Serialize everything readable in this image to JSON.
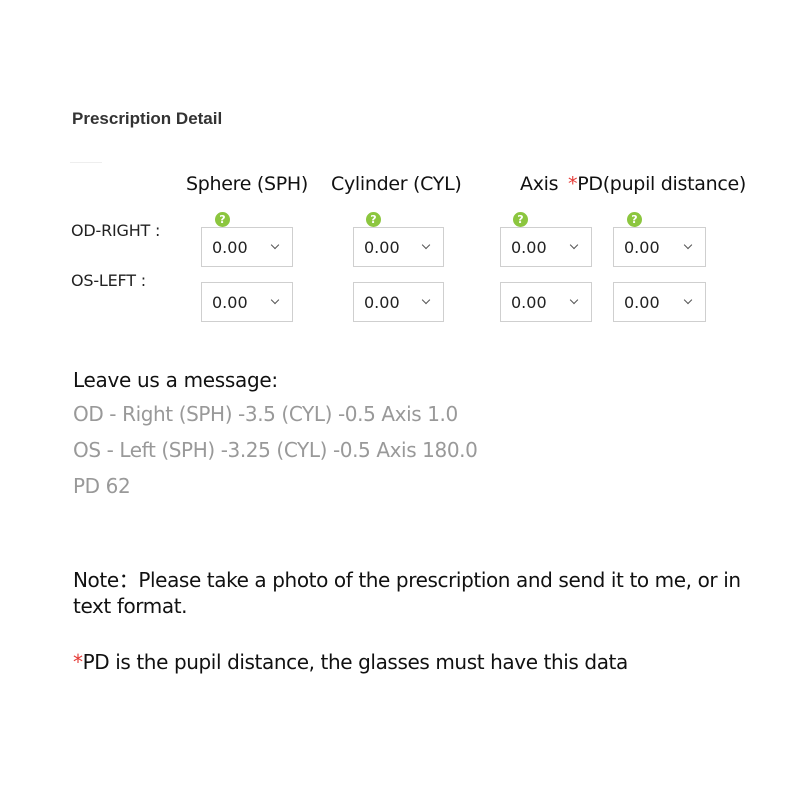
{
  "form": {
    "title": "Prescription Detail",
    "columns": {
      "sph": "Sphere (SPH)",
      "cyl": "Cylinder (CYL)",
      "axis": "Axis",
      "pd_star": "*",
      "pd": "PD(pupil distance)"
    },
    "help_glyph": "?",
    "rows": {
      "od": {
        "label": "OD-RIGHT :",
        "sph": "0.00",
        "cyl": "0.00",
        "axis": "0.00",
        "pd": "0.00"
      },
      "os": {
        "label": "OS-LEFT :",
        "sph": "0.00",
        "cyl": "0.00",
        "axis": "0.00",
        "pd": "0.00"
      }
    }
  },
  "message": {
    "label": "Leave us a message:",
    "lines": [
      "OD - Right (SPH) -3.5 (CYL) -0.5 Axis 1.0",
      "OS - Left (SPH) -3.25 (CYL) -0.5 Axis 180.0",
      "PD 62"
    ]
  },
  "note": "Note：Please take a photo of the prescription and send it to me, or in text format.",
  "pd_note": {
    "star": "*",
    "text": "PD is the pupil distance, the glasses must have this data"
  },
  "colors": {
    "help_icon": "#8cc63f",
    "required": "#e53935",
    "message_text": "#999999"
  },
  "icons": {
    "help": "question-circle-icon",
    "dropdown": "chevron-down-icon"
  }
}
